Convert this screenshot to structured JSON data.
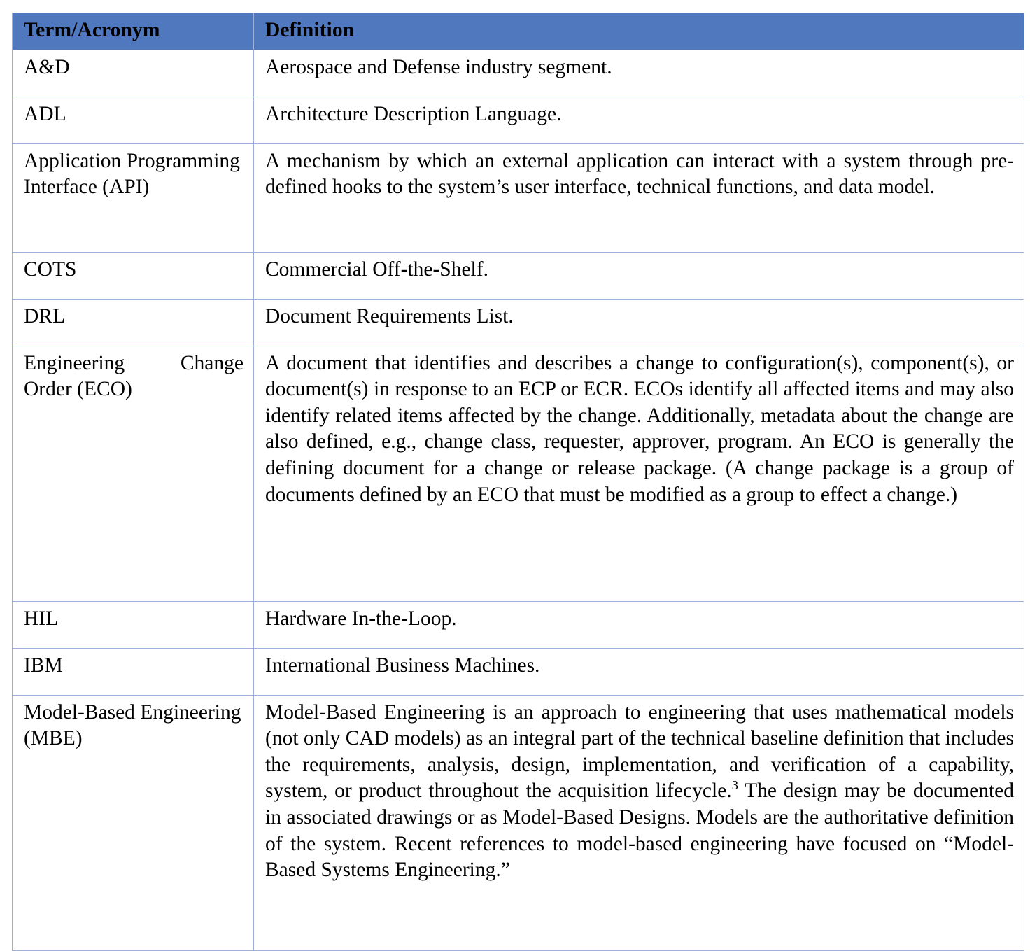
{
  "table": {
    "headers": {
      "term": "Term/Acronym",
      "definition": "Definition"
    },
    "header_bg": "#5078BE",
    "header_text_color": "#FFFFFF",
    "border_color": "#9DB0DC",
    "rows": [
      {
        "term": "A&D",
        "definition": "Aerospace and Defense industry segment."
      },
      {
        "term": "ADL",
        "definition": "Architecture Description Language."
      },
      {
        "term": "Application Programming Interface (API)",
        "definition": "A mechanism by which an external application can interact with a system through pre-defined hooks to the system’s user interface, technical functions, and data model."
      },
      {
        "term": "COTS",
        "definition": "Commercial Off-the-Shelf."
      },
      {
        "term": "DRL",
        "definition": "Document Requirements List."
      },
      {
        "term": "Engineering Change Order (ECO)",
        "definition": "A document that identifies and describes a change to configuration(s), component(s), or document(s) in response to an ECP or ECR. ECOs identify all affected items and may also identify related items affected by the change. Additionally, metadata about the change are also defined, e.g., change class, requester, approver, program. An ECO is generally the defining document for a change or release package. (A change package is a group of documents defined by an ECO that must be modified as a group to effect a change.)"
      },
      {
        "term": "HIL",
        "definition": "Hardware In-the-Loop."
      },
      {
        "term": "IBM",
        "definition": "International Business Machines."
      },
      {
        "term": "Model-Based Engineering (MBE)",
        "definition_part1": "Model-Based Engineering is an approach to engineering that uses mathematical models (not only CAD models) as an integral part of the technical baseline definition that includes the requirements, analysis, design, implementation, and verification of a capability, system, or product throughout the acquisition lifecycle.",
        "footnote_marker": "3",
        "definition_part2": " The design may be documented in associated drawings or as Model-Based Designs. Models are the authoritative definition of the system. Recent references to model-based engineering have focused on “Model-Based Systems Engineering.”"
      }
    ]
  }
}
